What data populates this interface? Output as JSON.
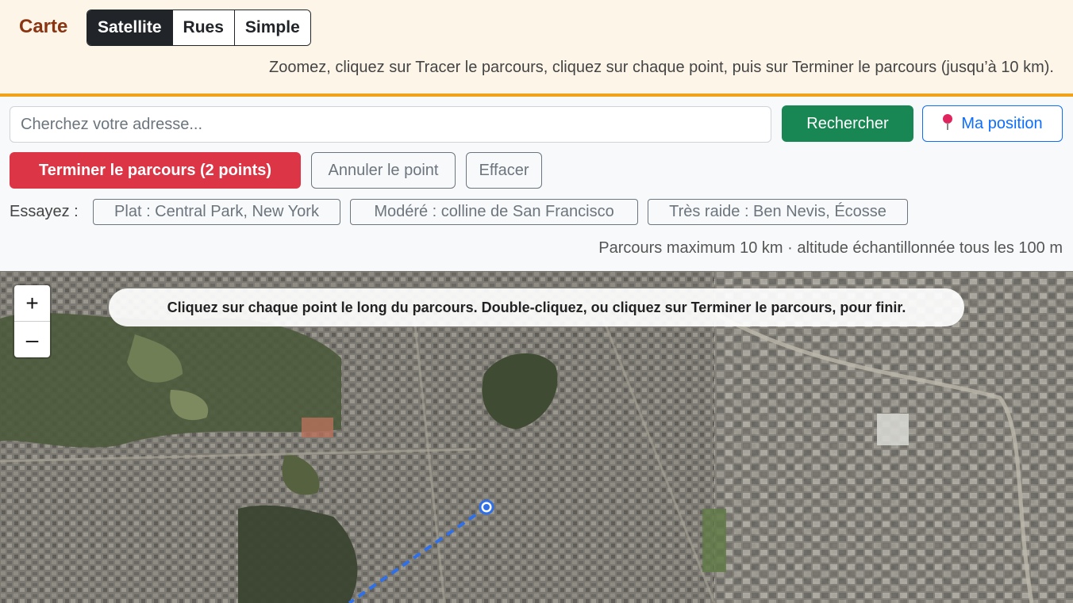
{
  "header": {
    "title": "Carte",
    "layers": [
      "Satellite",
      "Rues",
      "Simple"
    ],
    "active_layer": "Satellite",
    "hint": "Zoomez, cliquez sur Tracer le parcours, cliquez sur chaque point, puis sur Terminer le parcours (jusqu’à 10 km)."
  },
  "search": {
    "placeholder": "Cherchez votre adresse...",
    "value": "",
    "search_label": "Rechercher",
    "locate_label": "Ma position"
  },
  "route": {
    "finish_label": "Terminer le parcours (2 points)",
    "undo_label": "Annuler le point",
    "clear_label": "Effacer"
  },
  "presets": {
    "label": "Essayez :",
    "items": [
      "Plat : Central Park, New York",
      "Modéré : colline de San Francisco",
      "Très raide : Ben Nevis, Écosse"
    ]
  },
  "note": "Parcours maximum 10 km · altitude échantillonnée tous les 100 m",
  "map": {
    "zoom_in": "+",
    "zoom_out": "–",
    "banner": "Cliquez sur chaque point le long du parcours. Double-cliquez, ou cliquez sur Terminer le parcours, pour finir.",
    "route_color": "#2f6fe8",
    "point_count": 2
  },
  "colors": {
    "accent": "#f0a21a",
    "title": "#8a3412",
    "search_button": "#198754",
    "finish_button": "#dc3545",
    "locate_button": "#0d6efd"
  }
}
